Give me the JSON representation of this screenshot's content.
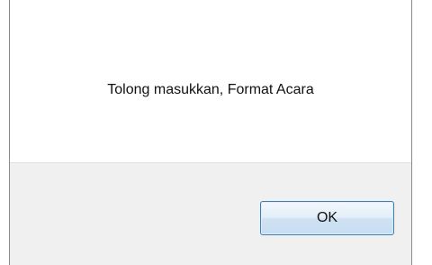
{
  "dialog": {
    "message": "Tolong masukkan, Format Acara",
    "ok_label": "OK"
  },
  "colors": {
    "button_border": "#3c7fb1",
    "footer_bg": "#f0f0f0",
    "window_border": "#8a8a8a"
  }
}
